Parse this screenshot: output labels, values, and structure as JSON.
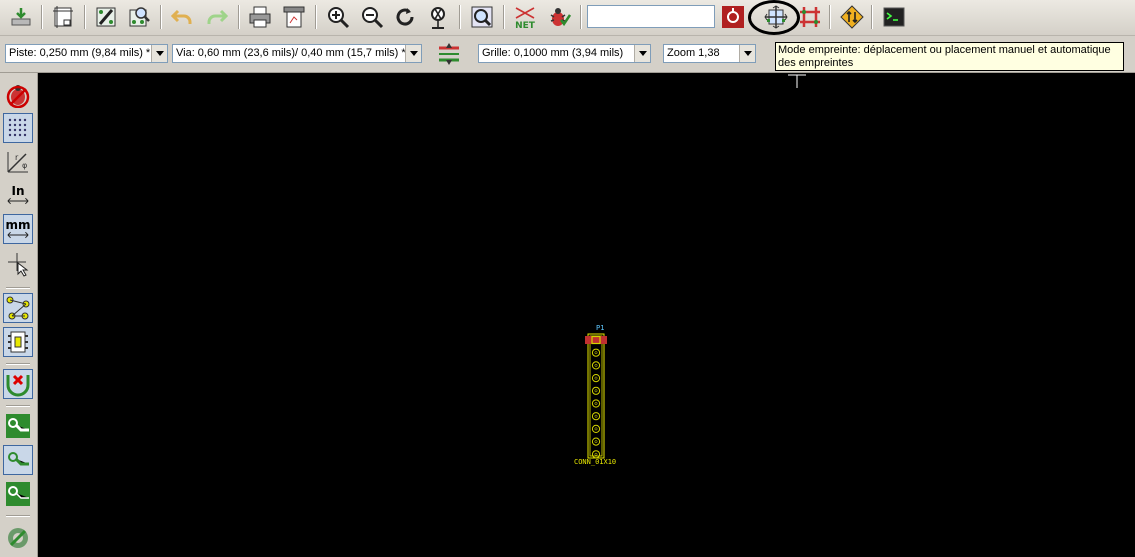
{
  "toolbar": {
    "search_value": "",
    "buttons": [
      "save-icon",
      "page-settings-icon",
      "edit-footprint-icon",
      "footprint-viewer-icon",
      "undo-icon",
      "redo-icon",
      "print-icon",
      "plot-icon",
      "zoom-in-icon",
      "zoom-out-icon",
      "redraw-icon",
      "zoom-auto-icon",
      "find-icon",
      "netlist-icon",
      "drc-icon",
      "module-mode-icon",
      "track-mode-icon",
      "autorouter-icon",
      "scripting-console-icon"
    ]
  },
  "options_bar": {
    "track_width": "Piste: 0,250 mm (9,84 mils) *",
    "via_size": "Via: 0,60 mm (23,6 mils)/ 0,40 mm (15,7 mils) *",
    "grid": "Grille: 0,1000 mm (3,94 mils)",
    "zoom": "Zoom 1,38"
  },
  "tooltip": {
    "text": "Mode empreinte: déplacement ou placement manuel et automatique des empreintes"
  },
  "left_toolbar": {
    "inch_label": "In",
    "mm_label": "mm"
  },
  "canvas": {
    "footprint_reference": "P1",
    "footprint_value": "CONN_01X10",
    "pin_count": 10
  },
  "colors": {
    "canvas_bg": "#000000",
    "footprint_outline": "#e8e800",
    "pad_ring": "#d4d400",
    "pad1": "#c03030",
    "reference_text": "#5fc8ff",
    "tooltip_bg": "#ffffe1"
  }
}
